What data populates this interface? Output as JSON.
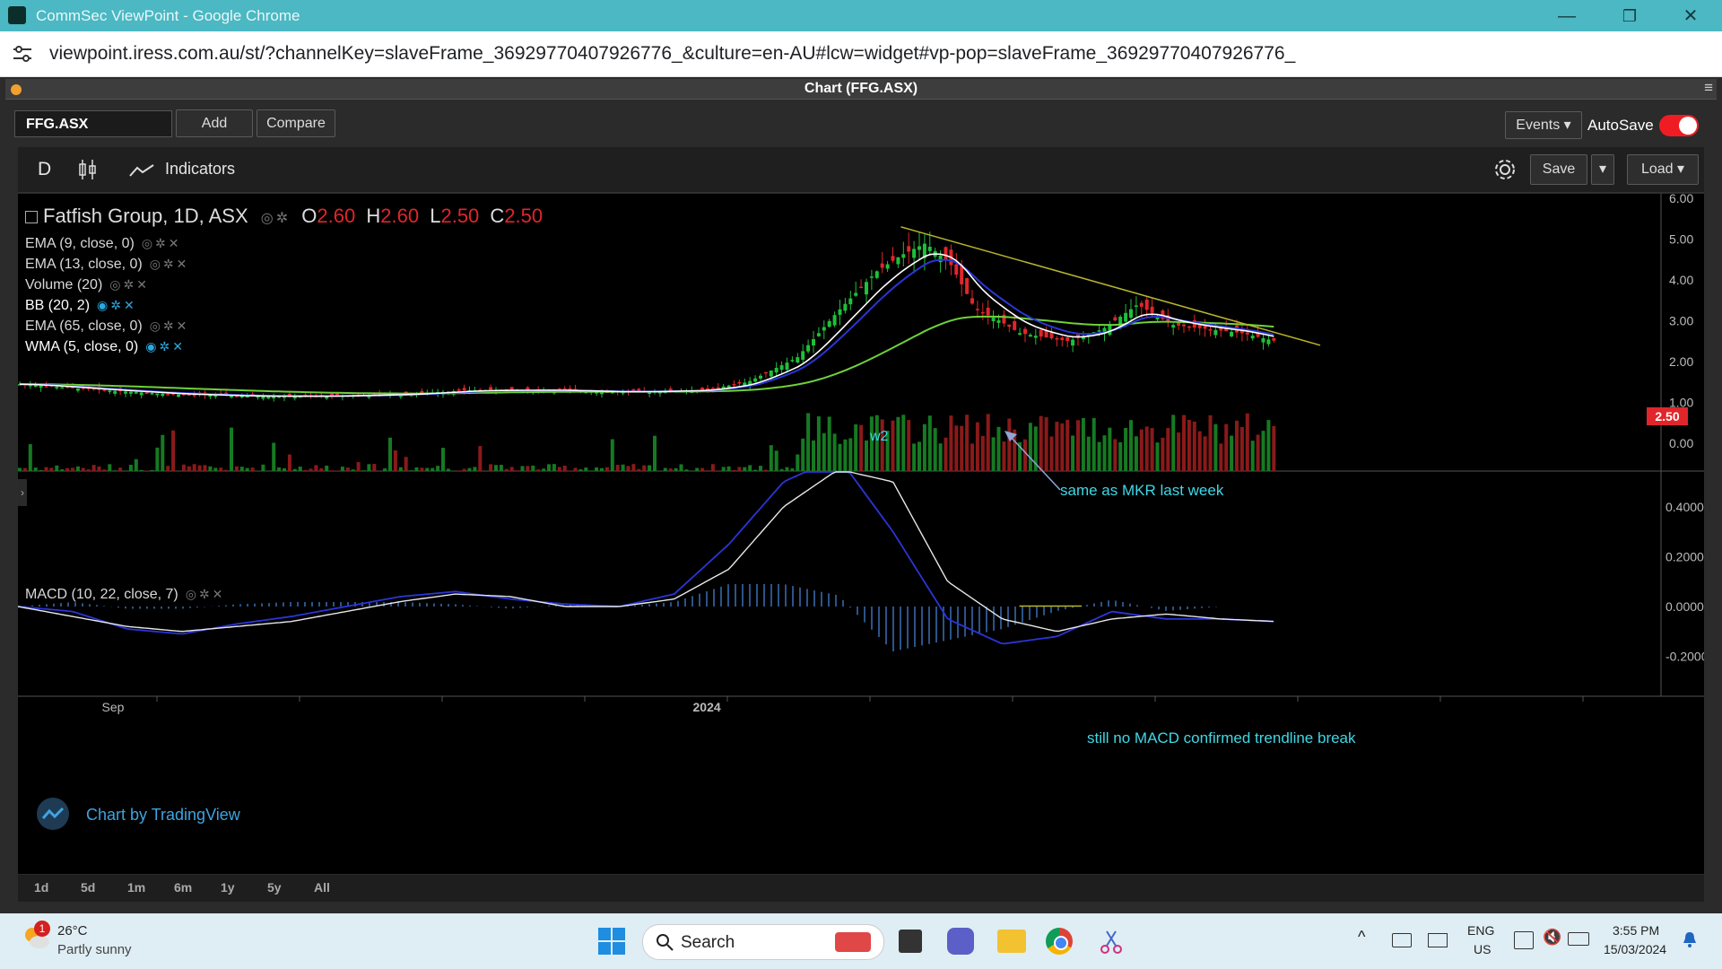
{
  "window": {
    "title": "CommSec ViewPoint - Google Chrome",
    "url": "viewpoint.iress.com.au/st/?channelKey=slaveFrame_36929770407926776_&culture=en-AU#lcw=widget#vp-pop=slaveFrame_36929770407926776_",
    "min_glyph": "—",
    "restore_glyph": "❐",
    "close_glyph": "✕"
  },
  "panel": {
    "title": "Chart (FFG.ASX)",
    "menu_glyph": "≡"
  },
  "toolbar": {
    "symbol": "FFG.ASX",
    "add_label": "Add",
    "compare_label": "Compare",
    "events_label": "Events ▾",
    "autosave_label": "AutoSave",
    "autosave_on": true
  },
  "chart_toolbar": {
    "interval": "D",
    "indicators_label": "Indicators",
    "save_label": "Save",
    "load_label": "Load ▾",
    "dropdown_glyph": "▾"
  },
  "legend": {
    "title": "Fatfish Group, 1D, ASX",
    "o_label": "O",
    "o_value": "2.60",
    "h_label": "H",
    "h_value": "2.60",
    "l_label": "L",
    "l_value": "2.50",
    "c_label": "C",
    "c_value": "2.50",
    "indicators": [
      {
        "label": "EMA (9, close, 0)",
        "active": false
      },
      {
        "label": "EMA (13, close, 0)",
        "active": false
      },
      {
        "label": "Volume (20)",
        "active": false
      },
      {
        "label": "BB (20, 2)",
        "active": true
      },
      {
        "label": "EMA (65, close, 0)",
        "active": false
      },
      {
        "label": "WMA (5, close, 0)",
        "active": true
      }
    ],
    "macd_label": "MACD (10, 22, close, 7)"
  },
  "annotations": {
    "w2": "w2",
    "mkr_note": "same as MKR last week",
    "macd_note": "still no MACD confirmed trendline break"
  },
  "branding": {
    "label": "Chart by TradingView"
  },
  "colors": {
    "up": "#1fc03a",
    "down": "#e0262b",
    "ema_fast": "#ffffff",
    "ema_slow": "#2a35d8",
    "ema65": "#6fd13a",
    "trendline": "#b8b62a",
    "note": "#3fd8e6",
    "price_tag": "#e0262b"
  },
  "chart_data": [
    {
      "type": "candlestick",
      "title": "Fatfish Group, 1D, ASX",
      "x_tick_labels": [
        "Sep",
        "2024"
      ],
      "y_tick_labels": [
        "6.00",
        "5.00",
        "4.00",
        "3.00",
        "2.00",
        "1.00",
        "0.00"
      ],
      "ylim": [
        0,
        6.5
      ],
      "last_price_label": "2.50",
      "close_path": {
        "x": [
          "2023-08-15",
          "2023-09-01",
          "2023-09-15",
          "2023-10-01",
          "2023-10-15",
          "2023-11-01",
          "2023-11-15",
          "2023-12-01",
          "2023-12-15",
          "2024-01-01",
          "2024-01-10",
          "2024-01-20",
          "2024-01-28",
          "2024-02-05",
          "2024-02-10",
          "2024-02-15",
          "2024-02-20",
          "2024-02-25",
          "2024-03-01",
          "2024-03-05",
          "2024-03-10",
          "2024-03-15",
          "2024-03-22",
          "2024-03-29",
          "2024-04-05",
          "2024-04-12",
          "2024-04-19",
          "2024-04-26"
        ],
        "close": [
          1.45,
          1.3,
          1.2,
          1.15,
          1.15,
          1.2,
          1.3,
          1.3,
          1.25,
          1.3,
          1.5,
          2.1,
          3.2,
          4.2,
          4.6,
          4.9,
          4.4,
          3.3,
          3.0,
          2.7,
          2.6,
          2.5,
          2.8,
          3.4,
          2.9,
          2.8,
          2.7,
          2.5
        ]
      },
      "trendline": {
        "from": {
          "x": "2024-02-10",
          "y": 5.3
        },
        "to": {
          "x": "2024-05-05",
          "y": 2.4
        }
      }
    },
    {
      "type": "line",
      "title": "MACD (10, 22, close, 7)",
      "y_tick_labels": [
        "0.4000",
        "0.2000",
        "0.0000",
        "-0.2000"
      ],
      "ylim": [
        -0.33,
        0.55
      ],
      "series": [
        {
          "values": [
            0.0,
            -0.04,
            -0.08,
            -0.1,
            -0.08,
            -0.06,
            -0.02,
            0.02,
            0.05,
            0.04,
            0.0,
            0.0,
            0.03,
            0.15,
            0.4,
            0.55,
            0.5,
            0.1,
            -0.05,
            -0.1,
            -0.05,
            -0.03,
            -0.05,
            -0.06
          ]
        },
        {
          "values": [
            0.0,
            -0.02,
            -0.09,
            -0.11,
            -0.07,
            -0.04,
            -0.0,
            0.04,
            0.06,
            0.03,
            0.01,
            0.0,
            0.05,
            0.25,
            0.5,
            0.6,
            0.3,
            -0.05,
            -0.15,
            -0.12,
            -0.02,
            -0.05,
            -0.05,
            -0.06
          ]
        }
      ]
    }
  ],
  "range_buttons": [
    "1d",
    "5d",
    "1m",
    "6m",
    "1y",
    "5y",
    "All"
  ],
  "taskbar": {
    "weather_temp": "26°C",
    "weather_desc": "Partly sunny",
    "weather_badge": "1",
    "search_label": "Search",
    "lang_top": "ENG",
    "lang_bottom": "US",
    "time": "3:55 PM",
    "date": "15/03/2024"
  }
}
